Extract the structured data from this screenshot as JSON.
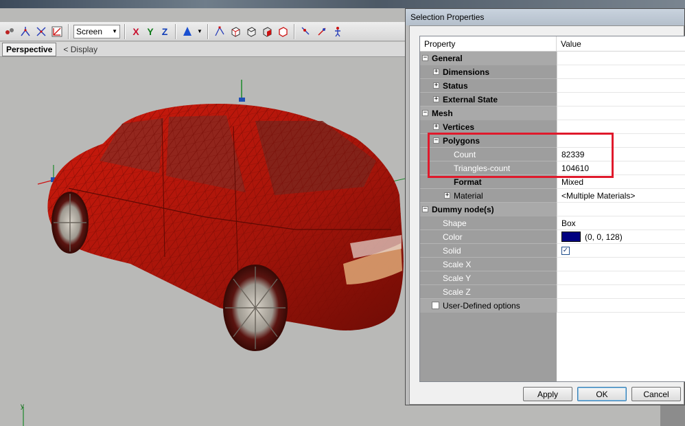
{
  "toolbar": {
    "coord_combo": "Screen",
    "axis_x": "X",
    "axis_y": "Y",
    "axis_z": "Z"
  },
  "viewport": {
    "tab_label": "Perspective",
    "display_link": "<  Display",
    "y_axis_label": "y",
    "mesh_color": "#b51208"
  },
  "dialog": {
    "title": "Selection Properties",
    "columns": {
      "property": "Property",
      "value": "Value"
    },
    "rows": [
      {
        "label": "General",
        "level": 0,
        "kind": "category",
        "expander": "−",
        "value": ""
      },
      {
        "label": "Dimensions",
        "level": 1,
        "kind": "group",
        "expander": "+",
        "value": ""
      },
      {
        "label": "Status",
        "level": 1,
        "kind": "group",
        "expander": "+",
        "value": ""
      },
      {
        "label": "External State",
        "level": 1,
        "kind": "group",
        "expander": "+",
        "value": ""
      },
      {
        "label": "Mesh",
        "level": 0,
        "kind": "category",
        "expander": "−",
        "value": ""
      },
      {
        "label": "Vertices",
        "level": 1,
        "kind": "group",
        "expander": "+",
        "value": ""
      },
      {
        "label": "Polygons",
        "level": 1,
        "kind": "group",
        "expander": "−",
        "value": ""
      },
      {
        "label": "Count",
        "level": 2,
        "kind": "prop",
        "value": "82339"
      },
      {
        "label": "Triangles-count",
        "level": 2,
        "kind": "prop",
        "value": "104610"
      },
      {
        "label": "Format",
        "level": 2,
        "kind": "propbold",
        "value": "Mixed"
      },
      {
        "label": "Material",
        "level": 2,
        "kind": "group",
        "expander": "+",
        "value": "<Multiple Materials>"
      },
      {
        "label": "Dummy node(s)",
        "level": 0,
        "kind": "category",
        "expander": "−",
        "value": ""
      },
      {
        "label": "Shape",
        "level": 1,
        "kind": "prop",
        "value": "Box"
      },
      {
        "label": "Color",
        "level": 1,
        "kind": "color",
        "value": "(0, 0, 128)",
        "swatch": "#000080"
      },
      {
        "label": "Solid",
        "level": 1,
        "kind": "check",
        "value": "✓"
      },
      {
        "label": "Scale X",
        "level": 1,
        "kind": "prop",
        "value": ""
      },
      {
        "label": "Scale Y",
        "level": 1,
        "kind": "prop",
        "value": ""
      },
      {
        "label": "Scale Z",
        "level": 1,
        "kind": "prop",
        "value": ""
      },
      {
        "label": "User-Defined options",
        "level": 0,
        "kind": "checkcat",
        "value": ""
      }
    ],
    "buttons": {
      "apply": "Apply",
      "ok": "OK",
      "cancel": "Cancel"
    }
  }
}
